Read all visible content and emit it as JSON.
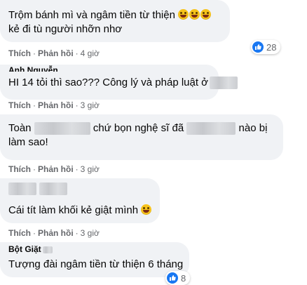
{
  "actions": {
    "like": "Thích",
    "reply": "Phản hồi",
    "separator": "·"
  },
  "comments": [
    {
      "text_a": "Trộm bánh mì và ngâm tiền từ thiện ",
      "text_b": " kẻ đi tù người nhỡn nhơ",
      "emoji_icon": "laughing-face-emoji",
      "time": "4 giờ",
      "reactions": "28"
    },
    {
      "author": "Anh Nguyễn",
      "text": "HI 14 tỏi thì sao??? Công lý và pháp luật ở",
      "time": "3 giờ"
    },
    {
      "text_a": "Toàn",
      "text_b": "chứ bọn nghệ sĩ đã",
      "text_c": "nào bị",
      "text_d": "làm sao!",
      "time": "3 giờ"
    },
    {
      "text": "Cái tít làm khối kẻ giật mình",
      "emoji_icon": "laughing-face-emoji",
      "time": "3 giờ"
    },
    {
      "author": "Bột Giặt",
      "text": "Tượng đài ngâm tiền từ thiện 6 tháng",
      "reactions": "8"
    }
  ],
  "colors": {
    "bubble": "#f0f2f5",
    "meta": "#65676b",
    "like": "#1877f2"
  }
}
